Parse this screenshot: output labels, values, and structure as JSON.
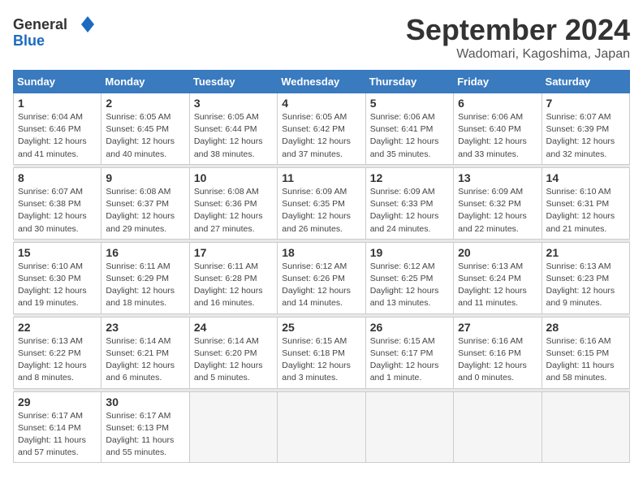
{
  "header": {
    "logo_general": "General",
    "logo_blue": "Blue",
    "title": "September 2024",
    "subtitle": "Wadomari, Kagoshima, Japan"
  },
  "days_of_week": [
    "Sunday",
    "Monday",
    "Tuesday",
    "Wednesday",
    "Thursday",
    "Friday",
    "Saturday"
  ],
  "weeks": [
    [
      {
        "day": "1",
        "sunrise": "6:04 AM",
        "sunset": "6:46 PM",
        "daylight": "12 hours and 41 minutes."
      },
      {
        "day": "2",
        "sunrise": "6:05 AM",
        "sunset": "6:45 PM",
        "daylight": "12 hours and 40 minutes."
      },
      {
        "day": "3",
        "sunrise": "6:05 AM",
        "sunset": "6:44 PM",
        "daylight": "12 hours and 38 minutes."
      },
      {
        "day": "4",
        "sunrise": "6:05 AM",
        "sunset": "6:42 PM",
        "daylight": "12 hours and 37 minutes."
      },
      {
        "day": "5",
        "sunrise": "6:06 AM",
        "sunset": "6:41 PM",
        "daylight": "12 hours and 35 minutes."
      },
      {
        "day": "6",
        "sunrise": "6:06 AM",
        "sunset": "6:40 PM",
        "daylight": "12 hours and 33 minutes."
      },
      {
        "day": "7",
        "sunrise": "6:07 AM",
        "sunset": "6:39 PM",
        "daylight": "12 hours and 32 minutes."
      }
    ],
    [
      {
        "day": "8",
        "sunrise": "6:07 AM",
        "sunset": "6:38 PM",
        "daylight": "12 hours and 30 minutes."
      },
      {
        "day": "9",
        "sunrise": "6:08 AM",
        "sunset": "6:37 PM",
        "daylight": "12 hours and 29 minutes."
      },
      {
        "day": "10",
        "sunrise": "6:08 AM",
        "sunset": "6:36 PM",
        "daylight": "12 hours and 27 minutes."
      },
      {
        "day": "11",
        "sunrise": "6:09 AM",
        "sunset": "6:35 PM",
        "daylight": "12 hours and 26 minutes."
      },
      {
        "day": "12",
        "sunrise": "6:09 AM",
        "sunset": "6:33 PM",
        "daylight": "12 hours and 24 minutes."
      },
      {
        "day": "13",
        "sunrise": "6:09 AM",
        "sunset": "6:32 PM",
        "daylight": "12 hours and 22 minutes."
      },
      {
        "day": "14",
        "sunrise": "6:10 AM",
        "sunset": "6:31 PM",
        "daylight": "12 hours and 21 minutes."
      }
    ],
    [
      {
        "day": "15",
        "sunrise": "6:10 AM",
        "sunset": "6:30 PM",
        "daylight": "12 hours and 19 minutes."
      },
      {
        "day": "16",
        "sunrise": "6:11 AM",
        "sunset": "6:29 PM",
        "daylight": "12 hours and 18 minutes."
      },
      {
        "day": "17",
        "sunrise": "6:11 AM",
        "sunset": "6:28 PM",
        "daylight": "12 hours and 16 minutes."
      },
      {
        "day": "18",
        "sunrise": "6:12 AM",
        "sunset": "6:26 PM",
        "daylight": "12 hours and 14 minutes."
      },
      {
        "day": "19",
        "sunrise": "6:12 AM",
        "sunset": "6:25 PM",
        "daylight": "12 hours and 13 minutes."
      },
      {
        "day": "20",
        "sunrise": "6:13 AM",
        "sunset": "6:24 PM",
        "daylight": "12 hours and 11 minutes."
      },
      {
        "day": "21",
        "sunrise": "6:13 AM",
        "sunset": "6:23 PM",
        "daylight": "12 hours and 9 minutes."
      }
    ],
    [
      {
        "day": "22",
        "sunrise": "6:13 AM",
        "sunset": "6:22 PM",
        "daylight": "12 hours and 8 minutes."
      },
      {
        "day": "23",
        "sunrise": "6:14 AM",
        "sunset": "6:21 PM",
        "daylight": "12 hours and 6 minutes."
      },
      {
        "day": "24",
        "sunrise": "6:14 AM",
        "sunset": "6:20 PM",
        "daylight": "12 hours and 5 minutes."
      },
      {
        "day": "25",
        "sunrise": "6:15 AM",
        "sunset": "6:18 PM",
        "daylight": "12 hours and 3 minutes."
      },
      {
        "day": "26",
        "sunrise": "6:15 AM",
        "sunset": "6:17 PM",
        "daylight": "12 hours and 1 minute."
      },
      {
        "day": "27",
        "sunrise": "6:16 AM",
        "sunset": "6:16 PM",
        "daylight": "12 hours and 0 minutes."
      },
      {
        "day": "28",
        "sunrise": "6:16 AM",
        "sunset": "6:15 PM",
        "daylight": "11 hours and 58 minutes."
      }
    ],
    [
      {
        "day": "29",
        "sunrise": "6:17 AM",
        "sunset": "6:14 PM",
        "daylight": "11 hours and 57 minutes."
      },
      {
        "day": "30",
        "sunrise": "6:17 AM",
        "sunset": "6:13 PM",
        "daylight": "11 hours and 55 minutes."
      },
      null,
      null,
      null,
      null,
      null
    ]
  ]
}
